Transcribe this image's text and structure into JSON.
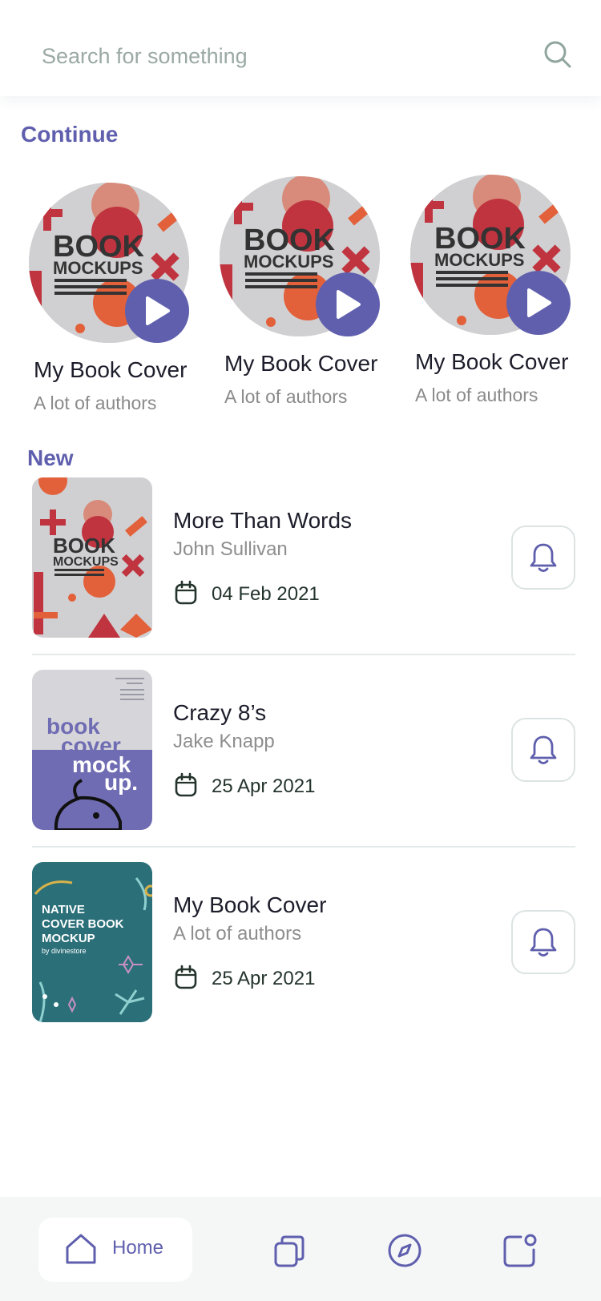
{
  "search": {
    "placeholder": "Search for something",
    "icon": "search-icon"
  },
  "sections": {
    "continue_title": "Continue",
    "new_title": "New"
  },
  "continue_items": [
    {
      "cover_text_main": "BOOK",
      "cover_text_sub": "MOCKUPS",
      "title": "My Book Cover",
      "subtitle": "A lot of authors"
    },
    {
      "cover_text_main": "BOOK",
      "cover_text_sub": "MOCKUPS",
      "title": "My Book Cover",
      "subtitle": "A lot of authors"
    },
    {
      "cover_text_main": "BOOK",
      "cover_text_sub": "MOCKUPS",
      "title": "My Book Cover",
      "subtitle": "A lot of authors"
    }
  ],
  "new_items": [
    {
      "title": "More Than Words",
      "author": "John Sullivan",
      "date": "04 Feb 2021",
      "cover_text_main": "BOOK",
      "cover_text_sub": "MOCKUPS"
    },
    {
      "title": "Crazy 8’s",
      "author": "Jake Knapp",
      "date": "25 Apr 2021",
      "cover_text": "book cover mock up."
    },
    {
      "title": "My Book Cover",
      "author": "A lot of authors",
      "date": "25 Apr 2021",
      "cover_text_line1": "NATIVE",
      "cover_text_line2": "COVER BOOK",
      "cover_text_line3": "MOCKUP",
      "cover_text_by": "by divinestore"
    }
  ],
  "nav": {
    "home_label": "Home"
  },
  "colors": {
    "accent": "#5f5fae",
    "divider": "#e4eaea",
    "text": "#1d1d2b",
    "muted": "#8e8e8e"
  }
}
